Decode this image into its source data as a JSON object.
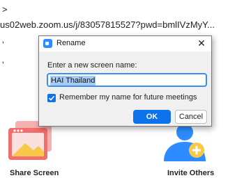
{
  "background": {
    "fragment_top": ">",
    "meeting_url": "us02web.zoom.us/j/83057815527?pwd=bmlIVzMyY...",
    "fragment_mid1": "ʼ",
    "fragment_mid2": "ʼ"
  },
  "actions": {
    "share_screen": {
      "label": "Share Screen",
      "icon": "share-screen-icon",
      "color": "#f26d6d"
    },
    "invite_others": {
      "label": "Invite Others",
      "icon": "invite-others-icon",
      "color": "#2d8cff"
    }
  },
  "dialog": {
    "title": "Rename",
    "close_glyph": "✕",
    "prompt": "Enter a new screen name:",
    "name_value": "HAI Thailand",
    "remember_label": "Remember my name for future meetings",
    "remember_checked": true,
    "ok_label": "OK",
    "cancel_label": "Cancel",
    "accent_color": "#0e72ed"
  }
}
